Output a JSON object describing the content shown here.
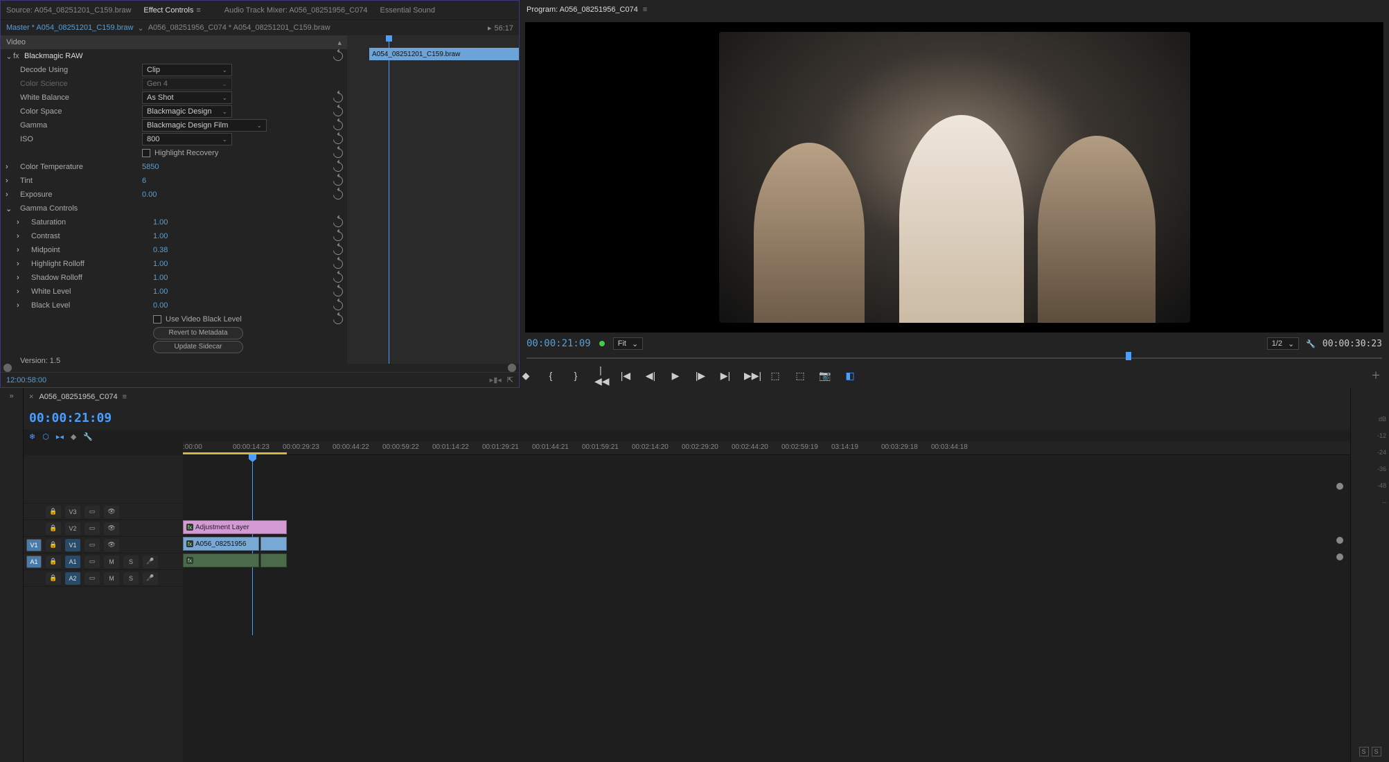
{
  "ec": {
    "tabs": {
      "source": "Source: A054_08251201_C159.braw",
      "effect_controls": "Effect Controls",
      "audio_mixer": "Audio Track Mixer: A056_08251956_C074",
      "essential_sound": "Essential Sound"
    },
    "header": {
      "master": "Master * A054_08251201_C159.braw",
      "clip": "A056_08251956_C074 * A054_08251201_C159.braw",
      "tc_right": "56:17"
    },
    "video_label": "Video",
    "fx_name": "Blackmagic RAW",
    "timeline_clip": "A054_08251201_C159.braw",
    "params": {
      "decode_using": {
        "label": "Decode Using",
        "value": "Clip"
      },
      "color_science": {
        "label": "Color Science",
        "value": "Gen 4"
      },
      "white_balance": {
        "label": "White Balance",
        "value": "As Shot"
      },
      "color_space": {
        "label": "Color Space",
        "value": "Blackmagic Design"
      },
      "gamma": {
        "label": "Gamma",
        "value": "Blackmagic Design Film"
      },
      "iso": {
        "label": "ISO",
        "value": "800"
      },
      "highlight_recovery": "Highlight Recovery",
      "color_temperature": {
        "label": "Color Temperature",
        "value": "5850"
      },
      "tint": {
        "label": "Tint",
        "value": "6"
      },
      "exposure": {
        "label": "Exposure",
        "value": "0.00"
      },
      "gamma_controls": "Gamma Controls",
      "saturation": {
        "label": "Saturation",
        "value": "1.00"
      },
      "contrast": {
        "label": "Contrast",
        "value": "1.00"
      },
      "midpoint": {
        "label": "Midpoint",
        "value": "0.38"
      },
      "highlight_rolloff": {
        "label": "Highlight Rolloff",
        "value": "1.00"
      },
      "shadow_rolloff": {
        "label": "Shadow Rolloff",
        "value": "1.00"
      },
      "white_level": {
        "label": "White Level",
        "value": "1.00"
      },
      "black_level": {
        "label": "Black Level",
        "value": "0.00"
      },
      "use_video_black_level": "Use Video Black Level",
      "revert": "Revert to Metadata",
      "update": "Update Sidecar",
      "version": "Version: 1.5"
    },
    "footer_tc": "12:00:58:00"
  },
  "program": {
    "tab": "Program: A056_08251956_C074",
    "tc": "00:00:21:09",
    "fit": "Fit",
    "res": "1/2",
    "duration": "00:00:30:23"
  },
  "timeline": {
    "tab": "A056_08251956_C074",
    "tc": "00:00:21:09",
    "ruler": [
      ":00:00",
      "00:00:14:23",
      "00:00:29:23",
      "00:00:44:22",
      "00:00:59:22",
      "00:01:14:22",
      "00:01:29:21",
      "00:01:44:21",
      "00:01:59:21",
      "00:02:14:20",
      "00:02:29:20",
      "00:02:44:20",
      "00:02:59:19",
      "03:14:19",
      "00:03:29:18",
      "00:03:44:18"
    ],
    "tracks": {
      "v3": "V3",
      "v2": "V2",
      "v1": "V1",
      "a1": "A1",
      "a2": "A2"
    },
    "clips": {
      "adjustment": "Adjustment Layer",
      "video": "A056_08251956",
      "fx": "fx"
    },
    "meter_scale": [
      "dB",
      "-12",
      "-24",
      "-36",
      "-48",
      "--"
    ],
    "solo": "S"
  }
}
